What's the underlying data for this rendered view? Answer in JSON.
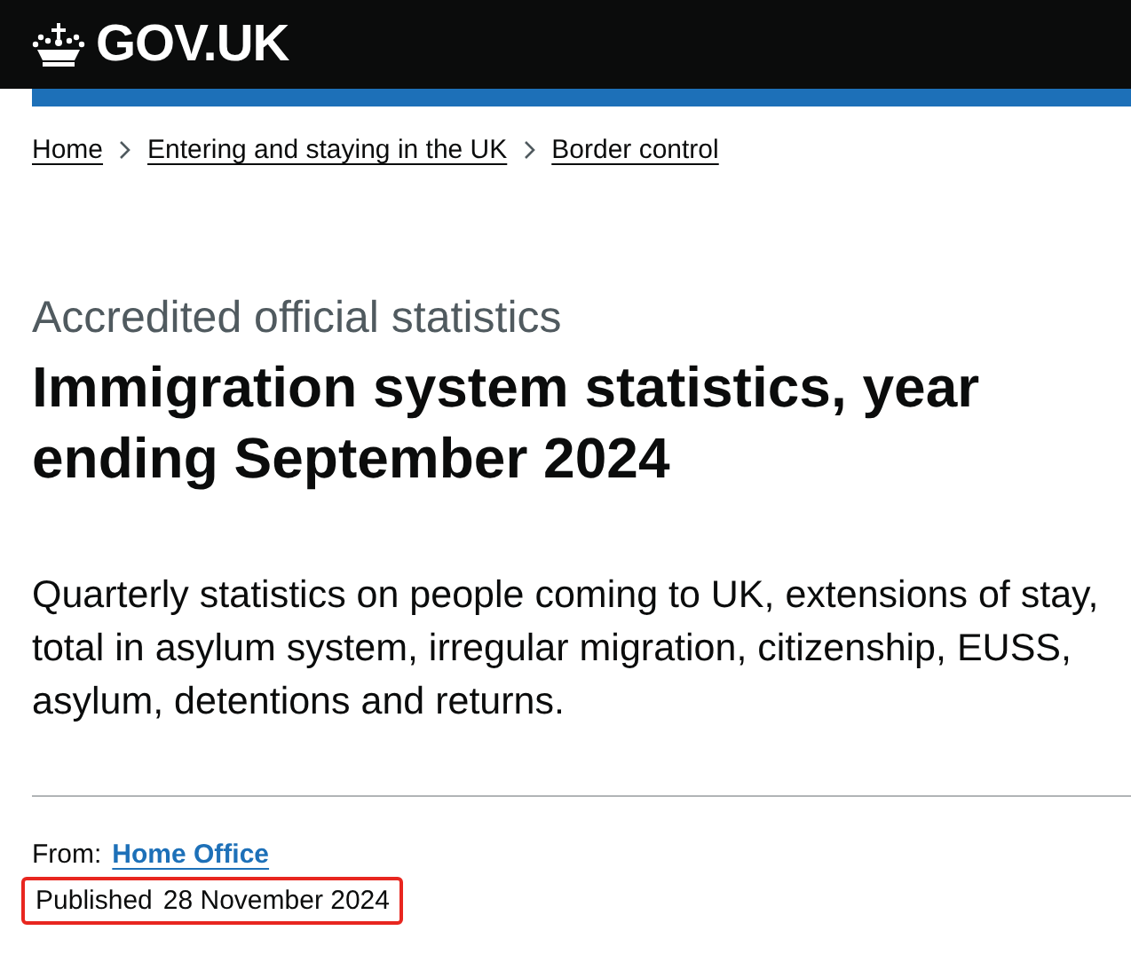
{
  "header": {
    "logo_text": "GOV.UK"
  },
  "breadcrumbs": [
    {
      "label": "Home"
    },
    {
      "label": "Entering and staying in the UK"
    },
    {
      "label": "Border control"
    }
  ],
  "caption": "Accredited official statistics",
  "title": "Immigration system statistics, year ending September 2024",
  "description": "Quarterly statistics on people coming to UK, extensions of stay, total in asylum system, irregular migration, citizenship, EUSS, asylum, detentions and returns.",
  "metadata": {
    "from_label": "From:",
    "from_link": "Home Office",
    "published_label": "Published",
    "published_date": "28 November 2024",
    "highlighted": true
  }
}
